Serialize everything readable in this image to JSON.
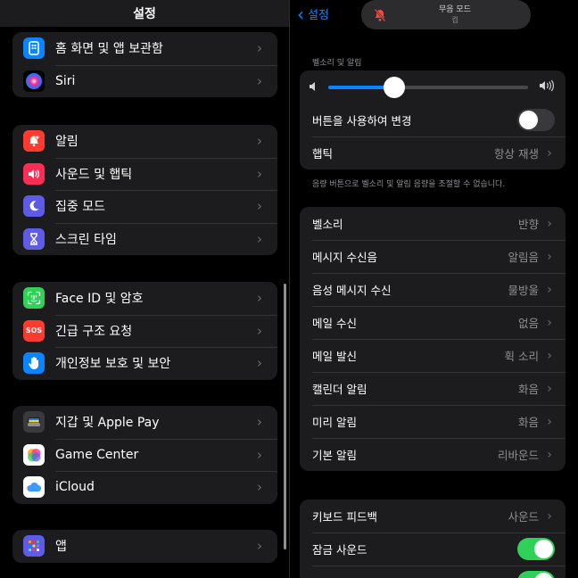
{
  "left": {
    "title": "설정",
    "groups": [
      {
        "items": [
          {
            "label": "홈 화면 및 앱 보관함",
            "icon": "home-screen-icon",
            "color": "#0a84ff"
          },
          {
            "label": "Siri",
            "icon": "siri-icon",
            "color": "#1c1c1e"
          }
        ]
      },
      {
        "items": [
          {
            "label": "알림",
            "icon": "bell-icon",
            "color": "#ff3b30"
          },
          {
            "label": "사운드 및 햅틱",
            "icon": "speaker-icon",
            "color": "#ff2d55"
          },
          {
            "label": "집중 모드",
            "icon": "moon-icon",
            "color": "#5e5ce6"
          },
          {
            "label": "스크린 타임",
            "icon": "hourglass-icon",
            "color": "#5e5ce6"
          }
        ]
      },
      {
        "items": [
          {
            "label": "Face ID 및 암호",
            "icon": "faceid-icon",
            "color": "#30d158"
          },
          {
            "label": "긴급 구조 요청",
            "icon": "sos-icon",
            "color": "#ff3b30",
            "badge": "SOS"
          },
          {
            "label": "개인정보 보호 및 보안",
            "icon": "hand-icon",
            "color": "#0a84ff"
          }
        ]
      },
      {
        "items": [
          {
            "label": "지갑 및 Apple Pay",
            "icon": "wallet-icon",
            "color": "#3a3a3c"
          },
          {
            "label": "Game Center",
            "icon": "game-center-icon",
            "color": "#ffffff"
          },
          {
            "label": "iCloud",
            "icon": "icloud-icon",
            "color": "#ffffff"
          }
        ]
      },
      {
        "items": [
          {
            "label": "앱",
            "icon": "apps-icon",
            "color": "#5e5ce6"
          }
        ]
      }
    ]
  },
  "right": {
    "back_label": "설정",
    "silent": {
      "line1": "무음 모드",
      "line2": "켬"
    },
    "section1_header": "벨소리 및 알림",
    "volume": {
      "level": 0.33
    },
    "change_with_buttons": {
      "label": "버튼을 사용하여 변경",
      "on": false
    },
    "haptic": {
      "label": "햅틱",
      "value": "항상 재생"
    },
    "section1_footer": "음량 버튼으로 벨소리 및 알림 음량을 조절할 수 없습니다.",
    "sounds": [
      {
        "label": "벨소리",
        "value": "반향"
      },
      {
        "label": "메시지 수신음",
        "value": "알림음"
      },
      {
        "label": "음성 메시지 수신",
        "value": "물방울"
      },
      {
        "label": "메일 수신",
        "value": "없음"
      },
      {
        "label": "메일 발신",
        "value": "휙 소리"
      },
      {
        "label": "캘린더 알림",
        "value": "화음"
      },
      {
        "label": "미리 알림",
        "value": "화음"
      },
      {
        "label": "기본 알림",
        "value": "리바운드"
      }
    ],
    "keyboard_feedback": {
      "label": "키보드 피드백",
      "value": "사운드"
    },
    "lock_sound": {
      "label": "잠금 사운드",
      "on": true
    },
    "accent": "#0a84ff",
    "toggle_on_color": "#30d158"
  }
}
